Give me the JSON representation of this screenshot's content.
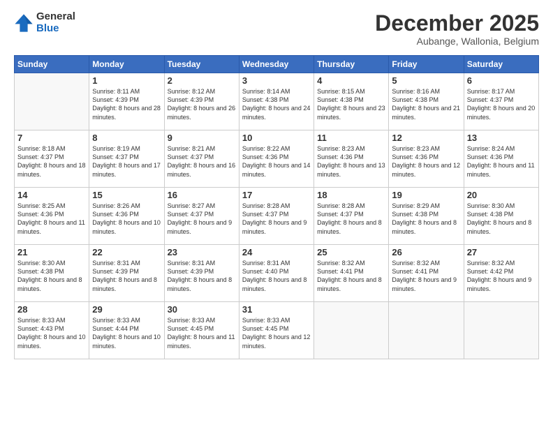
{
  "logo": {
    "general": "General",
    "blue": "Blue"
  },
  "header": {
    "month": "December 2025",
    "location": "Aubange, Wallonia, Belgium"
  },
  "weekdays": [
    "Sunday",
    "Monday",
    "Tuesday",
    "Wednesday",
    "Thursday",
    "Friday",
    "Saturday"
  ],
  "weeks": [
    [
      {
        "day": "",
        "info": ""
      },
      {
        "day": "1",
        "info": "Sunrise: 8:11 AM\nSunset: 4:39 PM\nDaylight: 8 hours\nand 28 minutes."
      },
      {
        "day": "2",
        "info": "Sunrise: 8:12 AM\nSunset: 4:39 PM\nDaylight: 8 hours\nand 26 minutes."
      },
      {
        "day": "3",
        "info": "Sunrise: 8:14 AM\nSunset: 4:38 PM\nDaylight: 8 hours\nand 24 minutes."
      },
      {
        "day": "4",
        "info": "Sunrise: 8:15 AM\nSunset: 4:38 PM\nDaylight: 8 hours\nand 23 minutes."
      },
      {
        "day": "5",
        "info": "Sunrise: 8:16 AM\nSunset: 4:38 PM\nDaylight: 8 hours\nand 21 minutes."
      },
      {
        "day": "6",
        "info": "Sunrise: 8:17 AM\nSunset: 4:37 PM\nDaylight: 8 hours\nand 20 minutes."
      }
    ],
    [
      {
        "day": "7",
        "info": "Sunrise: 8:18 AM\nSunset: 4:37 PM\nDaylight: 8 hours\nand 18 minutes."
      },
      {
        "day": "8",
        "info": "Sunrise: 8:19 AM\nSunset: 4:37 PM\nDaylight: 8 hours\nand 17 minutes."
      },
      {
        "day": "9",
        "info": "Sunrise: 8:21 AM\nSunset: 4:37 PM\nDaylight: 8 hours\nand 16 minutes."
      },
      {
        "day": "10",
        "info": "Sunrise: 8:22 AM\nSunset: 4:36 PM\nDaylight: 8 hours\nand 14 minutes."
      },
      {
        "day": "11",
        "info": "Sunrise: 8:23 AM\nSunset: 4:36 PM\nDaylight: 8 hours\nand 13 minutes."
      },
      {
        "day": "12",
        "info": "Sunrise: 8:23 AM\nSunset: 4:36 PM\nDaylight: 8 hours\nand 12 minutes."
      },
      {
        "day": "13",
        "info": "Sunrise: 8:24 AM\nSunset: 4:36 PM\nDaylight: 8 hours\nand 11 minutes."
      }
    ],
    [
      {
        "day": "14",
        "info": "Sunrise: 8:25 AM\nSunset: 4:36 PM\nDaylight: 8 hours\nand 11 minutes."
      },
      {
        "day": "15",
        "info": "Sunrise: 8:26 AM\nSunset: 4:36 PM\nDaylight: 8 hours\nand 10 minutes."
      },
      {
        "day": "16",
        "info": "Sunrise: 8:27 AM\nSunset: 4:37 PM\nDaylight: 8 hours\nand 9 minutes."
      },
      {
        "day": "17",
        "info": "Sunrise: 8:28 AM\nSunset: 4:37 PM\nDaylight: 8 hours\nand 9 minutes."
      },
      {
        "day": "18",
        "info": "Sunrise: 8:28 AM\nSunset: 4:37 PM\nDaylight: 8 hours\nand 8 minutes."
      },
      {
        "day": "19",
        "info": "Sunrise: 8:29 AM\nSunset: 4:38 PM\nDaylight: 8 hours\nand 8 minutes."
      },
      {
        "day": "20",
        "info": "Sunrise: 8:30 AM\nSunset: 4:38 PM\nDaylight: 8 hours\nand 8 minutes."
      }
    ],
    [
      {
        "day": "21",
        "info": "Sunrise: 8:30 AM\nSunset: 4:38 PM\nDaylight: 8 hours\nand 8 minutes."
      },
      {
        "day": "22",
        "info": "Sunrise: 8:31 AM\nSunset: 4:39 PM\nDaylight: 8 hours\nand 8 minutes."
      },
      {
        "day": "23",
        "info": "Sunrise: 8:31 AM\nSunset: 4:39 PM\nDaylight: 8 hours\nand 8 minutes."
      },
      {
        "day": "24",
        "info": "Sunrise: 8:31 AM\nSunset: 4:40 PM\nDaylight: 8 hours\nand 8 minutes."
      },
      {
        "day": "25",
        "info": "Sunrise: 8:32 AM\nSunset: 4:41 PM\nDaylight: 8 hours\nand 8 minutes."
      },
      {
        "day": "26",
        "info": "Sunrise: 8:32 AM\nSunset: 4:41 PM\nDaylight: 8 hours\nand 9 minutes."
      },
      {
        "day": "27",
        "info": "Sunrise: 8:32 AM\nSunset: 4:42 PM\nDaylight: 8 hours\nand 9 minutes."
      }
    ],
    [
      {
        "day": "28",
        "info": "Sunrise: 8:33 AM\nSunset: 4:43 PM\nDaylight: 8 hours\nand 10 minutes."
      },
      {
        "day": "29",
        "info": "Sunrise: 8:33 AM\nSunset: 4:44 PM\nDaylight: 8 hours\nand 10 minutes."
      },
      {
        "day": "30",
        "info": "Sunrise: 8:33 AM\nSunset: 4:45 PM\nDaylight: 8 hours\nand 11 minutes."
      },
      {
        "day": "31",
        "info": "Sunrise: 8:33 AM\nSunset: 4:45 PM\nDaylight: 8 hours\nand 12 minutes."
      },
      {
        "day": "",
        "info": ""
      },
      {
        "day": "",
        "info": ""
      },
      {
        "day": "",
        "info": ""
      }
    ]
  ]
}
